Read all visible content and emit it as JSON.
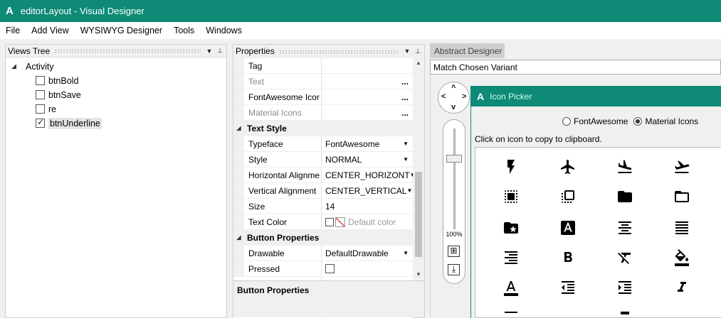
{
  "window": {
    "logo": "A",
    "title": "editorLayout - Visual Designer"
  },
  "menu": [
    "File",
    "Add View",
    "WYSIWYG Designer",
    "Tools",
    "Windows"
  ],
  "views_tree": {
    "header": "Views Tree",
    "root": "Activity",
    "items": [
      {
        "label": "btnBold",
        "checked": false
      },
      {
        "label": "btnSave",
        "checked": false
      },
      {
        "label": "re",
        "checked": false
      },
      {
        "label": "btnUnderline",
        "checked": true
      }
    ]
  },
  "properties": {
    "header": "Properties",
    "rows": [
      {
        "name": "Tag",
        "value": ""
      },
      {
        "name": "Text",
        "value": "",
        "ellipsis": "...",
        "grey": true
      },
      {
        "name": "FontAwesome Icor",
        "value": "",
        "ellipsis": "..."
      },
      {
        "name": "Material Icons",
        "value": "",
        "ellipsis": "...",
        "grey": true
      }
    ],
    "text_style": {
      "category": "Text Style",
      "rows": [
        {
          "name": "Typeface",
          "value": "FontAwesome"
        },
        {
          "name": "Style",
          "value": "NORMAL"
        },
        {
          "name": "Horizontal Alignme",
          "value": "CENTER_HORIZONT"
        },
        {
          "name": "Vertical Alignment",
          "value": "CENTER_VERTICAL"
        },
        {
          "name": "Size",
          "value": "14"
        },
        {
          "name": "Text Color",
          "value": "Default color"
        }
      ]
    },
    "button_props": {
      "category": "Button Properties",
      "rows": [
        {
          "name": "Drawable",
          "value": "DefaultDrawable"
        },
        {
          "name": "Pressed",
          "value": ""
        }
      ]
    },
    "description_title": "Button Properties"
  },
  "designer": {
    "tab": "Abstract Designer",
    "variant": "Match Chosen Variant",
    "zoom": "100%",
    "zoom_level": 0.75
  },
  "icon_picker": {
    "logo": "A",
    "title": "Icon Picker",
    "options": [
      "FontAwesome",
      "Material Icons"
    ],
    "selected": "Material Icons",
    "hint": "Click on icon to copy to clipboard.",
    "icons": [
      "flash-icon",
      "airplane-icon",
      "flight-land-icon",
      "flight-takeoff-icon",
      "select-all-icon",
      "flip-to-front-icon",
      "folder-filled-icon",
      "folder-outline-icon",
      "folder-special-icon",
      "font-download-icon",
      "align-center-icon",
      "align-justify-icon",
      "align-right-icon",
      "bold-icon",
      "clear-format-icon",
      "color-fill-icon",
      "text-color-icon",
      "indent-decrease-icon",
      "indent-increase-icon",
      "italic-icon"
    ]
  },
  "colors": {
    "accent": "#0e8a76",
    "background": "#f0f0f0"
  }
}
